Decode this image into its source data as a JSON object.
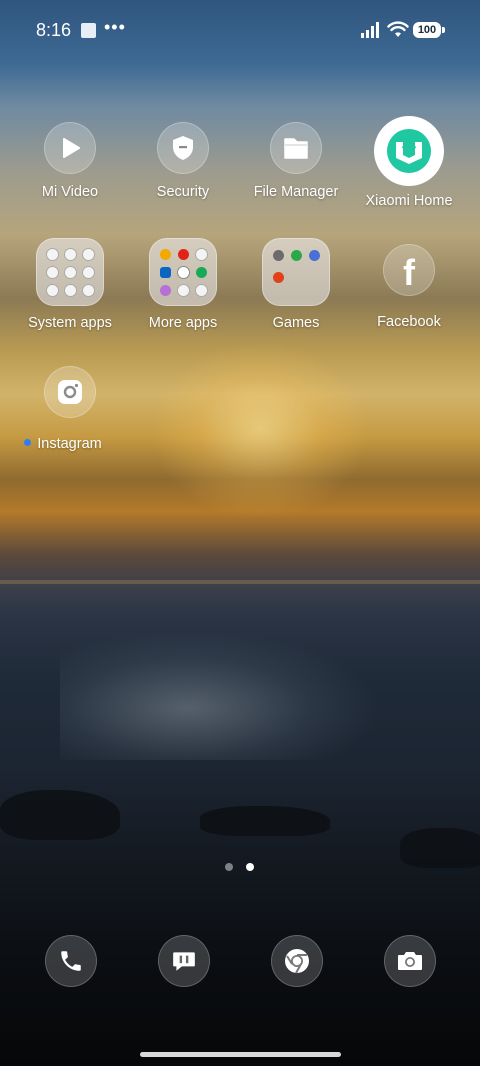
{
  "status_bar": {
    "time": "8:16",
    "battery": "100",
    "overflow": "•••"
  },
  "apps": [
    {
      "label": "Mi Video",
      "icon": "play-icon"
    },
    {
      "label": "Security",
      "icon": "shield-icon"
    },
    {
      "label": "File Manager",
      "icon": "folder-icon"
    },
    {
      "label": "Xiaomi Home",
      "icon": "mi-home-icon"
    },
    {
      "label": "System apps",
      "icon": "folder-icon"
    },
    {
      "label": "More apps",
      "icon": "folder-icon"
    },
    {
      "label": "Games",
      "icon": "folder-icon"
    },
    {
      "label": "Facebook",
      "icon": "facebook-icon"
    },
    {
      "label": "Instagram",
      "icon": "instagram-icon"
    }
  ],
  "dock": [
    {
      "icon": "phone-icon"
    },
    {
      "icon": "messages-icon"
    },
    {
      "icon": "chrome-icon"
    },
    {
      "icon": "camera-icon"
    }
  ],
  "pager": {
    "pages": 2,
    "active": 2
  },
  "colors": {
    "new_badge": "#2f7df6",
    "xiaomi_home": "#1fc8a0"
  }
}
